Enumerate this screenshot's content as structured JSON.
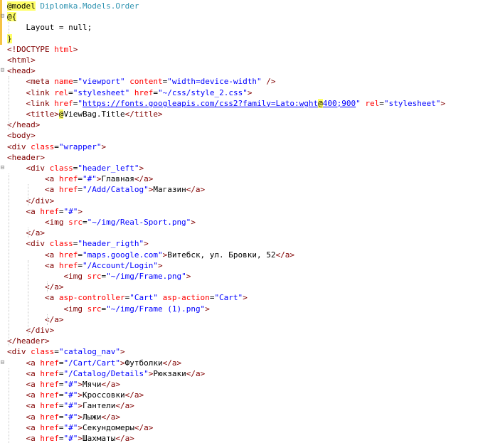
{
  "editor": {
    "lines": [
      [
        {
          "c": "@",
          "k": "rz"
        },
        {
          "c": "model",
          "k": "hl"
        },
        {
          "c": " "
        },
        {
          "c": "Diplomka.Models.Order",
          "k": "ty"
        }
      ],
      [
        {
          "c": "@{",
          "k": "hl"
        }
      ],
      [
        {
          "c": "    Layout = null;"
        }
      ],
      [
        {
          "c": "}",
          "k": "hl"
        }
      ],
      [
        {
          "c": "<!",
          "k": "t"
        },
        {
          "c": "DOCTYPE",
          "k": "t"
        },
        {
          "c": " "
        },
        {
          "c": "html",
          "k": "a"
        },
        {
          "c": ">",
          "k": "t"
        }
      ],
      [
        {
          "c": "<",
          "k": "t"
        },
        {
          "c": "html",
          "k": "t"
        },
        {
          "c": ">",
          "k": "t"
        }
      ],
      [
        {
          "c": "<",
          "k": "t"
        },
        {
          "c": "head",
          "k": "t"
        },
        {
          "c": ">",
          "k": "t"
        }
      ],
      [
        {
          "c": "    "
        },
        {
          "c": "<meta",
          "k": "t"
        },
        {
          "c": " "
        },
        {
          "c": "name",
          "k": "a"
        },
        {
          "c": "="
        },
        {
          "c": "\"viewport\"",
          "k": "v"
        },
        {
          "c": " "
        },
        {
          "c": "content",
          "k": "a"
        },
        {
          "c": "="
        },
        {
          "c": "\"width=device-width\"",
          "k": "v"
        },
        {
          "c": " />",
          "k": "t"
        }
      ],
      [
        {
          "c": "    "
        },
        {
          "c": "<link",
          "k": "t"
        },
        {
          "c": " "
        },
        {
          "c": "rel",
          "k": "a"
        },
        {
          "c": "="
        },
        {
          "c": "\"stylesheet\"",
          "k": "v"
        },
        {
          "c": " "
        },
        {
          "c": "href",
          "k": "a"
        },
        {
          "c": "="
        },
        {
          "c": "\"~/css/style_2.css\"",
          "k": "v"
        },
        {
          "c": ">",
          "k": "t"
        }
      ],
      [
        {
          "c": "    "
        },
        {
          "c": "<link",
          "k": "t"
        },
        {
          "c": " "
        },
        {
          "c": "href",
          "k": "a"
        },
        {
          "c": "="
        },
        {
          "c": "\"",
          "k": "v"
        },
        {
          "c": "https://fonts.googleapis.com/css2?family=Lato:wght",
          "k": "u"
        },
        {
          "c": "@",
          "k": "rz"
        },
        {
          "c": "400;900",
          "k": "u"
        },
        {
          "c": "\"",
          "k": "v"
        },
        {
          "c": " "
        },
        {
          "c": "rel",
          "k": "a"
        },
        {
          "c": "="
        },
        {
          "c": "\"stylesheet\"",
          "k": "v"
        },
        {
          "c": ">",
          "k": "t"
        }
      ],
      [
        {
          "c": "    "
        },
        {
          "c": "<title>",
          "k": "t"
        },
        {
          "c": "@",
          "k": "rz"
        },
        {
          "c": "ViewBag.Title"
        },
        {
          "c": "</title>",
          "k": "t"
        }
      ],
      [
        {
          "c": "</head>",
          "k": "t"
        }
      ],
      [
        {
          "c": "<body>",
          "k": "t"
        }
      ],
      [
        {
          "c": "<div",
          "k": "t"
        },
        {
          "c": " "
        },
        {
          "c": "class",
          "k": "a"
        },
        {
          "c": "="
        },
        {
          "c": "\"wrapper\"",
          "k": "v"
        },
        {
          "c": ">",
          "k": "t"
        }
      ],
      [
        {
          "c": "<header>",
          "k": "t"
        }
      ],
      [
        {
          "c": "    "
        },
        {
          "c": "<div",
          "k": "t"
        },
        {
          "c": " "
        },
        {
          "c": "class",
          "k": "a"
        },
        {
          "c": "="
        },
        {
          "c": "\"header_left\"",
          "k": "v"
        },
        {
          "c": ">",
          "k": "t"
        }
      ],
      [
        {
          "c": "        "
        },
        {
          "c": "<a",
          "k": "t"
        },
        {
          "c": " "
        },
        {
          "c": "href",
          "k": "a"
        },
        {
          "c": "="
        },
        {
          "c": "\"#\"",
          "k": "v"
        },
        {
          "c": ">",
          "k": "t"
        },
        {
          "c": "Главная"
        },
        {
          "c": "</a>",
          "k": "t"
        }
      ],
      [
        {
          "c": "        "
        },
        {
          "c": "<a",
          "k": "t"
        },
        {
          "c": " "
        },
        {
          "c": "href",
          "k": "a"
        },
        {
          "c": "="
        },
        {
          "c": "\"/Add/Catalog\"",
          "k": "v"
        },
        {
          "c": ">",
          "k": "t"
        },
        {
          "c": "Магазин"
        },
        {
          "c": "</a>",
          "k": "t"
        }
      ],
      [
        {
          "c": "    "
        },
        {
          "c": "</div>",
          "k": "t"
        }
      ],
      [
        {
          "c": "    "
        },
        {
          "c": "<a",
          "k": "t"
        },
        {
          "c": " "
        },
        {
          "c": "href",
          "k": "a"
        },
        {
          "c": "="
        },
        {
          "c": "\"#\"",
          "k": "v"
        },
        {
          "c": ">",
          "k": "t"
        }
      ],
      [
        {
          "c": "        "
        },
        {
          "c": "<img",
          "k": "t"
        },
        {
          "c": " "
        },
        {
          "c": "src",
          "k": "a"
        },
        {
          "c": "="
        },
        {
          "c": "\"~/img/Real-Sport.png\"",
          "k": "v"
        },
        {
          "c": ">",
          "k": "t"
        }
      ],
      [
        {
          "c": "    "
        },
        {
          "c": "</a>",
          "k": "t"
        }
      ],
      [
        {
          "c": "    "
        },
        {
          "c": "<div",
          "k": "t"
        },
        {
          "c": " "
        },
        {
          "c": "class",
          "k": "a"
        },
        {
          "c": "="
        },
        {
          "c": "\"header_rigth\"",
          "k": "v"
        },
        {
          "c": ">",
          "k": "t"
        }
      ],
      [
        {
          "c": "        "
        },
        {
          "c": "<a",
          "k": "t"
        },
        {
          "c": " "
        },
        {
          "c": "href",
          "k": "a"
        },
        {
          "c": "="
        },
        {
          "c": "\"maps.google.com\"",
          "k": "v"
        },
        {
          "c": ">",
          "k": "t"
        },
        {
          "c": "Витебск, ул. Бровки, 52"
        },
        {
          "c": "</a>",
          "k": "t"
        }
      ],
      [
        {
          "c": "        "
        },
        {
          "c": "<a",
          "k": "t"
        },
        {
          "c": " "
        },
        {
          "c": "href",
          "k": "a"
        },
        {
          "c": "="
        },
        {
          "c": "\"/Account/Login\"",
          "k": "v"
        },
        {
          "c": ">",
          "k": "t"
        }
      ],
      [
        {
          "c": "            "
        },
        {
          "c": "<img",
          "k": "t"
        },
        {
          "c": " "
        },
        {
          "c": "src",
          "k": "a"
        },
        {
          "c": "="
        },
        {
          "c": "\"~/img/Frame.png\"",
          "k": "v"
        },
        {
          "c": ">",
          "k": "t"
        }
      ],
      [
        {
          "c": "        "
        },
        {
          "c": "</a>",
          "k": "t"
        }
      ],
      [
        {
          "c": "        "
        },
        {
          "c": "<a",
          "k": "t"
        },
        {
          "c": " "
        },
        {
          "c": "asp-controller",
          "k": "a"
        },
        {
          "c": "="
        },
        {
          "c": "\"Cart\"",
          "k": "v"
        },
        {
          "c": " "
        },
        {
          "c": "asp-action",
          "k": "a"
        },
        {
          "c": "="
        },
        {
          "c": "\"Cart\"",
          "k": "v"
        },
        {
          "c": ">",
          "k": "t"
        }
      ],
      [
        {
          "c": "            "
        },
        {
          "c": "<img",
          "k": "t"
        },
        {
          "c": " "
        },
        {
          "c": "src",
          "k": "a"
        },
        {
          "c": "="
        },
        {
          "c": "\"~/img/Frame (1).png\"",
          "k": "v"
        },
        {
          "c": ">",
          "k": "t"
        }
      ],
      [
        {
          "c": "        "
        },
        {
          "c": "</a>",
          "k": "t"
        }
      ],
      [
        {
          "c": "    "
        },
        {
          "c": "</div>",
          "k": "t"
        }
      ],
      [
        {
          "c": "</header>",
          "k": "t"
        }
      ],
      [
        {
          "c": "<div",
          "k": "t"
        },
        {
          "c": " "
        },
        {
          "c": "class",
          "k": "a"
        },
        {
          "c": "="
        },
        {
          "c": "\"catalog_nav\"",
          "k": "v"
        },
        {
          "c": ">",
          "k": "t"
        }
      ],
      [
        {
          "c": "    "
        },
        {
          "c": "<a",
          "k": "t"
        },
        {
          "c": " "
        },
        {
          "c": "href",
          "k": "a"
        },
        {
          "c": "="
        },
        {
          "c": "\"/Cart/Cart\"",
          "k": "v"
        },
        {
          "c": ">",
          "k": "t"
        },
        {
          "c": "Футболки"
        },
        {
          "c": "</a>",
          "k": "t"
        }
      ],
      [
        {
          "c": "    "
        },
        {
          "c": "<a",
          "k": "t"
        },
        {
          "c": " "
        },
        {
          "c": "href",
          "k": "a"
        },
        {
          "c": "="
        },
        {
          "c": "\"/Catalog/Details\"",
          "k": "v"
        },
        {
          "c": ">",
          "k": "t"
        },
        {
          "c": "Рюкзаки"
        },
        {
          "c": "</a>",
          "k": "t"
        }
      ],
      [
        {
          "c": "    "
        },
        {
          "c": "<a",
          "k": "t"
        },
        {
          "c": " "
        },
        {
          "c": "href",
          "k": "a"
        },
        {
          "c": "="
        },
        {
          "c": "\"#\"",
          "k": "v"
        },
        {
          "c": ">",
          "k": "t"
        },
        {
          "c": "Мячи"
        },
        {
          "c": "</a>",
          "k": "t"
        }
      ],
      [
        {
          "c": "    "
        },
        {
          "c": "<a",
          "k": "t"
        },
        {
          "c": " "
        },
        {
          "c": "href",
          "k": "a"
        },
        {
          "c": "="
        },
        {
          "c": "\"#\"",
          "k": "v"
        },
        {
          "c": ">",
          "k": "t"
        },
        {
          "c": "Кроссовки"
        },
        {
          "c": "</a>",
          "k": "t"
        }
      ],
      [
        {
          "c": "    "
        },
        {
          "c": "<a",
          "k": "t"
        },
        {
          "c": " "
        },
        {
          "c": "href",
          "k": "a"
        },
        {
          "c": "="
        },
        {
          "c": "\"#\"",
          "k": "v"
        },
        {
          "c": ">",
          "k": "t"
        },
        {
          "c": "Гантели"
        },
        {
          "c": "</a>",
          "k": "t"
        }
      ],
      [
        {
          "c": "    "
        },
        {
          "c": "<a",
          "k": "t"
        },
        {
          "c": " "
        },
        {
          "c": "href",
          "k": "a"
        },
        {
          "c": "="
        },
        {
          "c": "\"#\"",
          "k": "v"
        },
        {
          "c": ">",
          "k": "t"
        },
        {
          "c": "Лыжи"
        },
        {
          "c": "</a>",
          "k": "t"
        }
      ],
      [
        {
          "c": "    "
        },
        {
          "c": "<a",
          "k": "t"
        },
        {
          "c": " "
        },
        {
          "c": "href",
          "k": "a"
        },
        {
          "c": "="
        },
        {
          "c": "\"#\"",
          "k": "v"
        },
        {
          "c": ">",
          "k": "t"
        },
        {
          "c": "Секундомеры"
        },
        {
          "c": "</a>",
          "k": "t"
        }
      ],
      [
        {
          "c": "    "
        },
        {
          "c": "<a",
          "k": "t"
        },
        {
          "c": " "
        },
        {
          "c": "href",
          "k": "a"
        },
        {
          "c": "="
        },
        {
          "c": "\"#\"",
          "k": "v"
        },
        {
          "c": ">",
          "k": "t"
        },
        {
          "c": "Шахматы"
        },
        {
          "c": "</a>",
          "k": "t"
        }
      ]
    ],
    "folds": [
      {
        "line": 1,
        "glyph": "⊟"
      },
      {
        "line": 6,
        "glyph": "⊟"
      },
      {
        "line": 15,
        "glyph": "⊟"
      },
      {
        "line": 33,
        "glyph": "⊟"
      }
    ],
    "colors": {
      "tag": "#800000",
      "attribute": "#ff0000",
      "value": "#0000ff",
      "razor_highlight": "#ffff66",
      "type": "#2b91af",
      "change_bar": "#f6c343"
    }
  }
}
